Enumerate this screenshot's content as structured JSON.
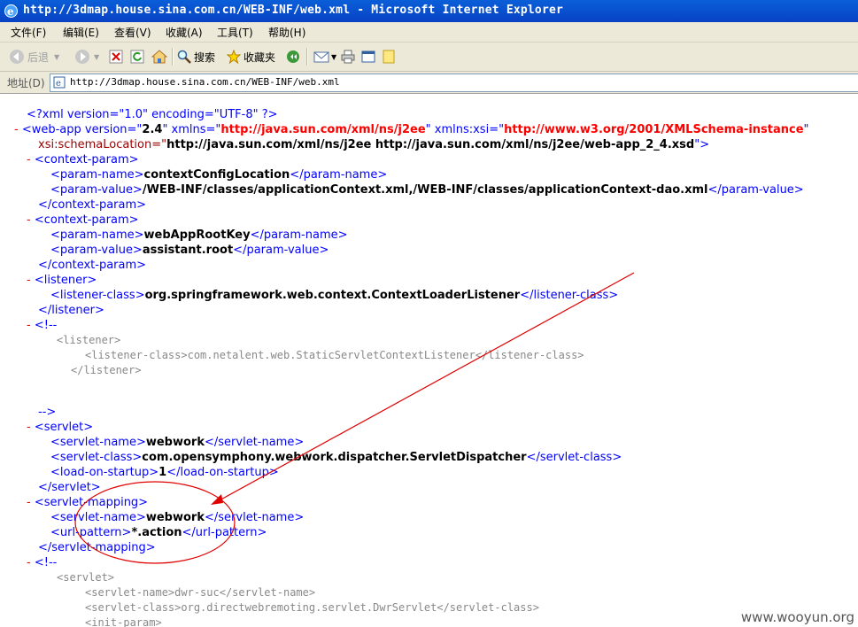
{
  "window": {
    "title": "http://3dmap.house.sina.com.cn/WEB-INF/web.xml - Microsoft Internet Explorer"
  },
  "menu": {
    "file": "文件(F)",
    "edit": "编辑(E)",
    "view": "查看(V)",
    "favorites": "收藏(A)",
    "tools": "工具(T)",
    "help": "帮助(H)"
  },
  "toolbar": {
    "back": "后退",
    "search": "搜索",
    "favorites": "收藏夹"
  },
  "address": {
    "label": "地址(D)",
    "url": "http://3dmap.house.sina.com.cn/WEB-INF/web.xml"
  },
  "xml": {
    "pi": "<?xml version=\"1.0\" encoding=\"UTF-8\" ?>",
    "webapp_open_a": "<web-app version=\"",
    "webapp_version": "2.4",
    "webapp_open_b": "\" xmlns=\"",
    "webapp_xmlns": "http://java.sun.com/xml/ns/j2ee",
    "webapp_open_c": "\" xmlns:xsi=\"",
    "webapp_xsi": "http://www.w3.org/2001/XMLSchema-instance",
    "webapp_open_d": "\"",
    "schema_attr": "xsi:schemaLocation=\"",
    "schema_val": "http://java.sun.com/xml/ns/j2ee http://java.sun.com/xml/ns/j2ee/web-app_2_4.xsd",
    "schema_end": "\">",
    "context_param_open": "<context-param>",
    "context_param_close": "</context-param>",
    "param_name_open": "<param-name>",
    "param_name_close": "</param-name>",
    "param_value_open": "<param-value>",
    "param_value_close": "</param-value>",
    "cp1_name": "contextConfigLocation",
    "cp1_value": "/WEB-INF/classes/applicationContext.xml,/WEB-INF/classes/applicationContext-dao.xml",
    "cp2_name": "webAppRootKey",
    "cp2_value": "assistant.root",
    "listener_open": "<listener>",
    "listener_close": "</listener>",
    "listener_class_open": "<listener-class>",
    "listener_class_close": "</listener-class>",
    "listener_class_value": "org.springframework.web.context.ContextLoaderListener",
    "comment_open": "<!--",
    "comment_close": "-->",
    "c1_line1": "<listener>",
    "c1_line2": "<listener-class>com.netalent.web.StaticServletContextListener</listener-class>",
    "c1_line3": "</listener>",
    "servlet_open": "<servlet>",
    "servlet_close": "</servlet>",
    "servlet_name_open": "<servlet-name>",
    "servlet_name_close": "</servlet-name>",
    "servlet_name_value": "webwork",
    "servlet_class_open": "<servlet-class>",
    "servlet_class_close": "</servlet-class>",
    "servlet_class_value": "com.opensymphony.webwork.dispatcher.ServletDispatcher",
    "los_open": "<load-on-startup>",
    "los_close": "</load-on-startup>",
    "los_value": "1",
    "mapping_open": "<servlet-mapping>",
    "mapping_close": "</servlet-mapping>",
    "url_pattern_open": "<url-pattern>",
    "url_pattern_close": "</url-pattern>",
    "url_pattern_value": "*.action",
    "c2_line1": "<servlet>",
    "c2_line2": "<servlet-name>dwr-suc</servlet-name>",
    "c2_line3": "<servlet-class>org.directwebremoting.servlet.DwrServlet</servlet-class>",
    "c2_line4": "<init-param>",
    "minus": "-"
  },
  "watermark": "www.wooyun.org",
  "colors": {
    "titlebar": "#0a5fd8",
    "chrome": "#ece9d8",
    "tag": "#990000",
    "attr_value": "#ff0000",
    "markup": "#0000ff",
    "annotation": "#ff0000"
  }
}
